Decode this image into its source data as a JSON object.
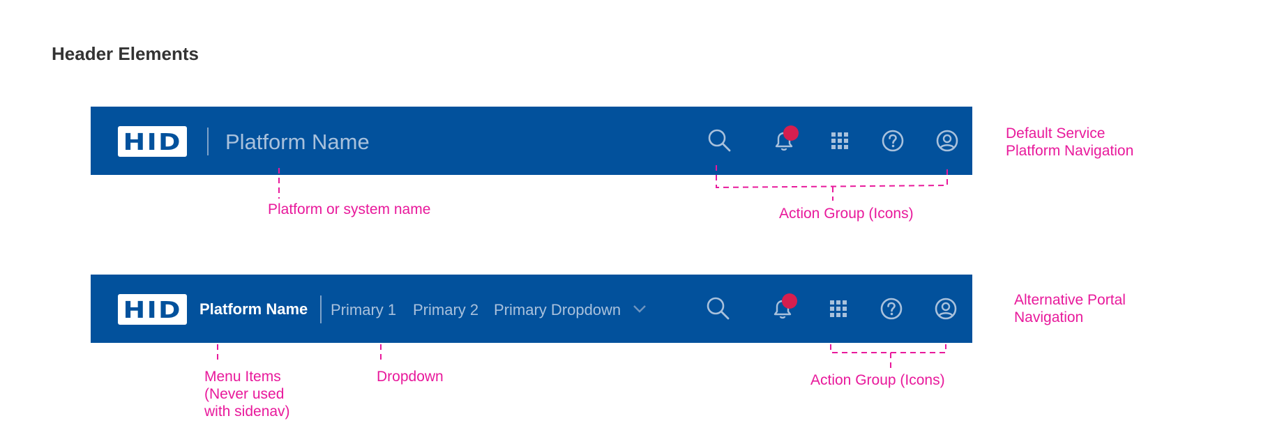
{
  "page": {
    "title": "Header Elements"
  },
  "brand": {
    "logo_text": "HID"
  },
  "colors": {
    "header_bg": "#02519c",
    "annotation": "#e8199b",
    "badge": "#d61f4f",
    "icon": "#a9c1dc"
  },
  "default_header": {
    "platform_name": "Platform Name",
    "icons": [
      "search-icon",
      "bell-icon",
      "apps-grid-icon",
      "help-icon",
      "user-icon"
    ],
    "side_label_line1": "Default Service",
    "side_label_line2": "Platform Navigation",
    "annotation_platform": "Platform or system name",
    "annotation_actions": "Action Group (Icons)"
  },
  "alt_header": {
    "platform_name": "Platform Name",
    "nav_items": [
      "Primary 1",
      "Primary 2",
      "Primary Dropdown"
    ],
    "icons": [
      "search-icon",
      "bell-icon",
      "apps-grid-icon",
      "help-icon",
      "user-icon"
    ],
    "side_label_line1": "Alternative Portal",
    "side_label_line2": "Navigation",
    "annotation_menu_line1": "Menu Items",
    "annotation_menu_line2": "(Never used",
    "annotation_menu_line3": "with sidenav)",
    "annotation_dropdown": "Dropdown",
    "annotation_actions": "Action Group (Icons)"
  }
}
